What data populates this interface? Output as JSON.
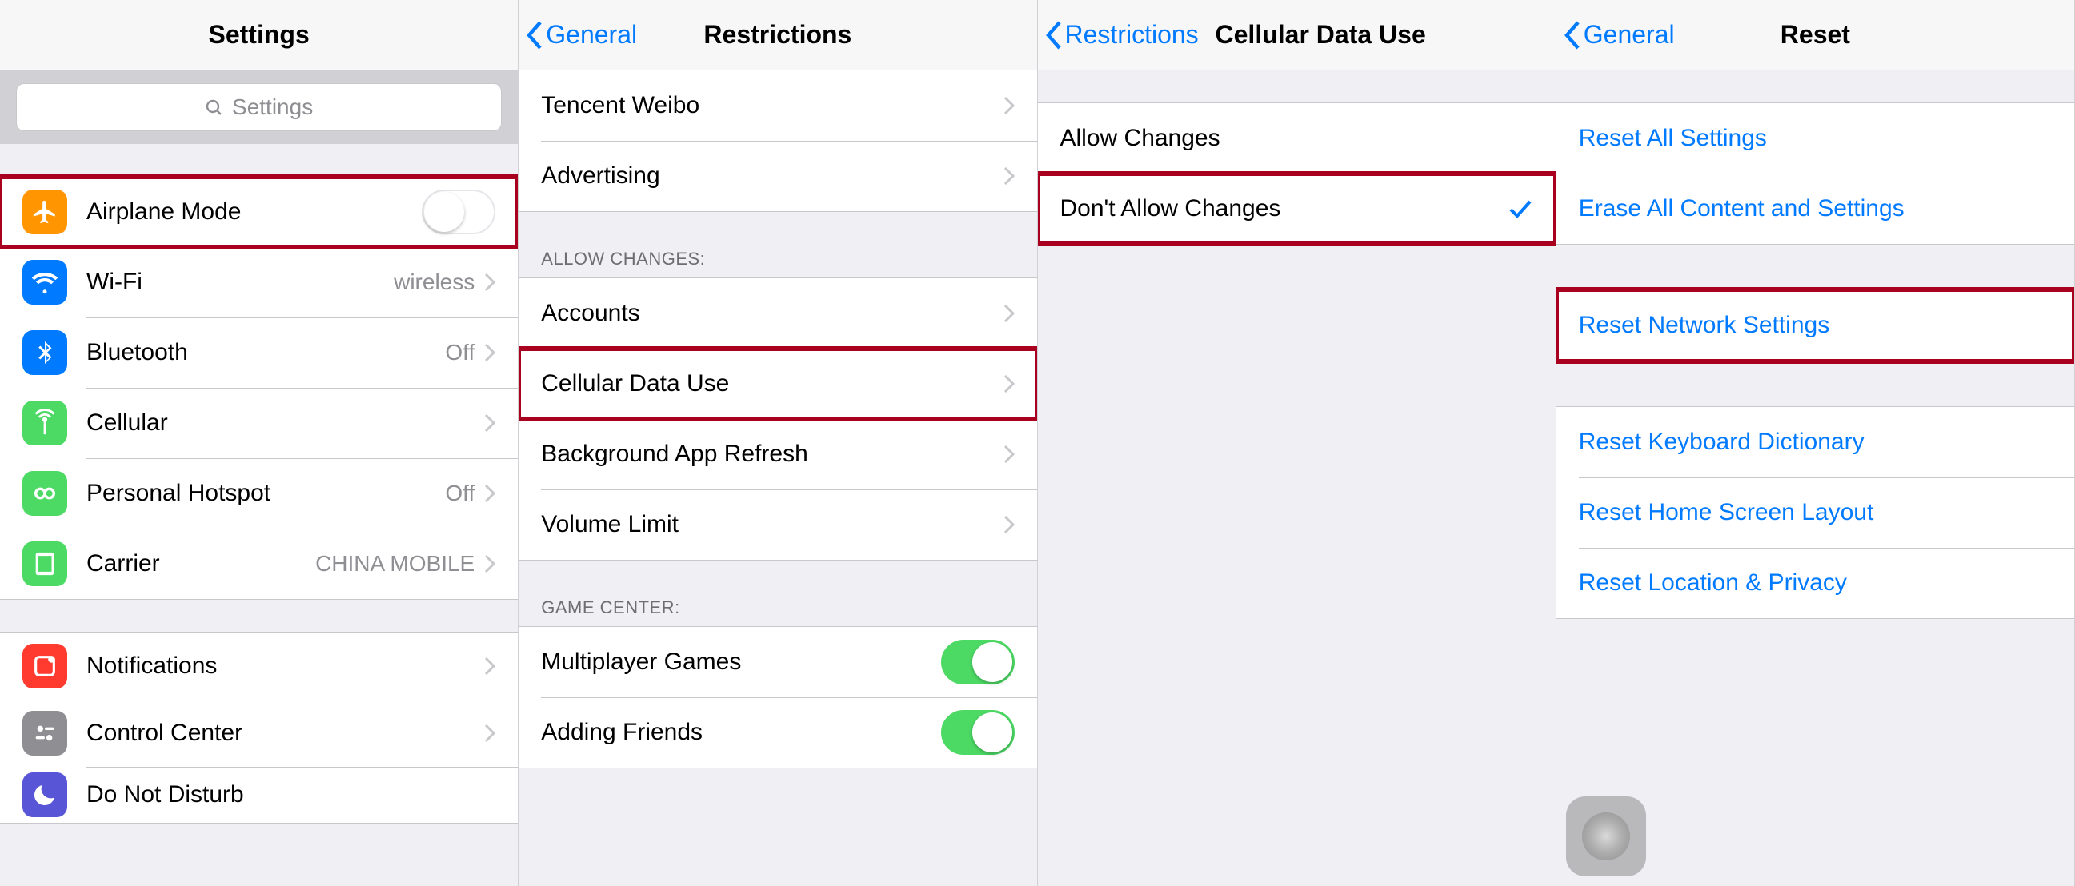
{
  "colors": {
    "accent": "#007aff",
    "green": "#4cd964",
    "orange": "#ff9500",
    "blue": "#007aff",
    "greenCell": "#4cd964",
    "greenCellAlt": "#34c759",
    "gray": "#8e8e93",
    "red": "#ff3b30",
    "purple": "#5856d6"
  },
  "panel1": {
    "title": "Settings",
    "search_placeholder": "Settings",
    "groupA": {
      "items": [
        {
          "label": "Airplane Mode",
          "icon": "airplane",
          "type": "toggle",
          "on": false,
          "highlight": true
        },
        {
          "label": "Wi-Fi",
          "icon": "wifi",
          "detail": "wireless",
          "type": "disclosure"
        },
        {
          "label": "Bluetooth",
          "icon": "bluetooth",
          "detail": "Off",
          "type": "disclosure"
        },
        {
          "label": "Cellular",
          "icon": "cellular",
          "type": "disclosure"
        },
        {
          "label": "Personal Hotspot",
          "icon": "hotspot",
          "detail": "Off",
          "type": "disclosure"
        },
        {
          "label": "Carrier",
          "icon": "carrier",
          "detail": "CHINA MOBILE",
          "type": "disclosure"
        }
      ]
    },
    "groupB": {
      "items": [
        {
          "label": "Notifications",
          "icon": "notifications",
          "type": "disclosure"
        },
        {
          "label": "Control Center",
          "icon": "controlcenter",
          "type": "disclosure"
        },
        {
          "label": "Do Not Disturb",
          "icon": "dnd",
          "type": "disclosure"
        }
      ]
    }
  },
  "panel2": {
    "back": "General",
    "title": "Restrictions",
    "groupA": {
      "items": [
        {
          "label": "Tencent Weibo",
          "type": "disclosure"
        },
        {
          "label": "Advertising",
          "type": "disclosure"
        }
      ]
    },
    "groupB": {
      "header": "ALLOW CHANGES:",
      "items": [
        {
          "label": "Accounts",
          "type": "disclosure"
        },
        {
          "label": "Cellular Data Use",
          "type": "disclosure",
          "highlight": true
        },
        {
          "label": "Background App Refresh",
          "type": "disclosure"
        },
        {
          "label": "Volume Limit",
          "type": "disclosure"
        }
      ]
    },
    "groupC": {
      "header": "GAME CENTER:",
      "items": [
        {
          "label": "Multiplayer Games",
          "type": "toggle",
          "on": true
        },
        {
          "label": "Adding Friends",
          "type": "toggle",
          "on": true
        }
      ]
    }
  },
  "panel3": {
    "back": "Restrictions",
    "title": "Cellular Data Use",
    "group": {
      "items": [
        {
          "label": "Allow Changes",
          "checked": false
        },
        {
          "label": "Don't Allow Changes",
          "checked": true,
          "highlight": true
        }
      ]
    }
  },
  "panel4": {
    "back": "General",
    "title": "Reset",
    "groupA": {
      "items": [
        {
          "label": "Reset All Settings"
        },
        {
          "label": "Erase All Content and Settings"
        }
      ]
    },
    "groupB": {
      "items": [
        {
          "label": "Reset Network Settings",
          "highlight": true
        }
      ]
    },
    "groupC": {
      "items": [
        {
          "label": "Reset Keyboard Dictionary"
        },
        {
          "label": "Reset Home Screen Layout"
        },
        {
          "label": "Reset Location & Privacy"
        }
      ]
    }
  }
}
